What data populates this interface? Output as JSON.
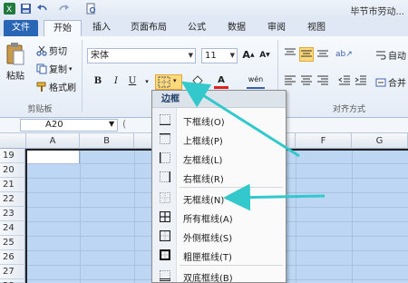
{
  "window": {
    "title": "毕节市劳动..."
  },
  "tabs": [
    {
      "label": "文件",
      "kind": "file"
    },
    {
      "label": "开始",
      "kind": "active"
    },
    {
      "label": "插入",
      "kind": "normal"
    },
    {
      "label": "页面布局",
      "kind": "normal"
    },
    {
      "label": "公式",
      "kind": "normal"
    },
    {
      "label": "数据",
      "kind": "normal"
    },
    {
      "label": "审阅",
      "kind": "normal"
    },
    {
      "label": "视图",
      "kind": "normal"
    }
  ],
  "clipboard": {
    "paste": "粘贴",
    "cut": "剪切",
    "copy": "复制",
    "format_painter": "格式刷",
    "group_label": "剪贴板"
  },
  "font": {
    "name": "宋体",
    "size": "11",
    "grow": "A",
    "shrink": "A",
    "bold": "B",
    "italic": "I",
    "underline": "U",
    "color_letter": "A",
    "phonetic": "wén"
  },
  "alignment": {
    "wrap": "自动",
    "merge": "合并",
    "group_label": "对齐方式"
  },
  "namebox": {
    "value": "A20"
  },
  "columns": [
    "A",
    "B",
    "F",
    "G"
  ],
  "rows": [
    "19",
    "20",
    "21",
    "22",
    "23",
    "24",
    "25",
    "26",
    "27",
    "28"
  ],
  "border_menu": {
    "title": "边框",
    "items": [
      {
        "label": "下框线(O)",
        "icon": "bottom-border-icon"
      },
      {
        "label": "上框线(P)",
        "icon": "top-border-icon"
      },
      {
        "label": "左框线(L)",
        "icon": "left-border-icon"
      },
      {
        "label": "右框线(R)",
        "icon": "right-border-icon"
      },
      {
        "label": "无框线(N)",
        "icon": "no-border-icon"
      },
      {
        "label": "所有框线(A)",
        "icon": "all-borders-icon"
      },
      {
        "label": "外侧框线(S)",
        "icon": "outside-borders-icon"
      },
      {
        "label": "粗匣框线(T)",
        "icon": "thick-box-border-icon"
      },
      {
        "label": "双底框线(B)",
        "icon": "double-bottom-border-icon"
      }
    ]
  },
  "colors": {
    "annotation_arrow": "#33c9cc",
    "file_tab": "#2a66b6",
    "selection": "#bcd6f4",
    "highlight": "#fcd97a"
  }
}
